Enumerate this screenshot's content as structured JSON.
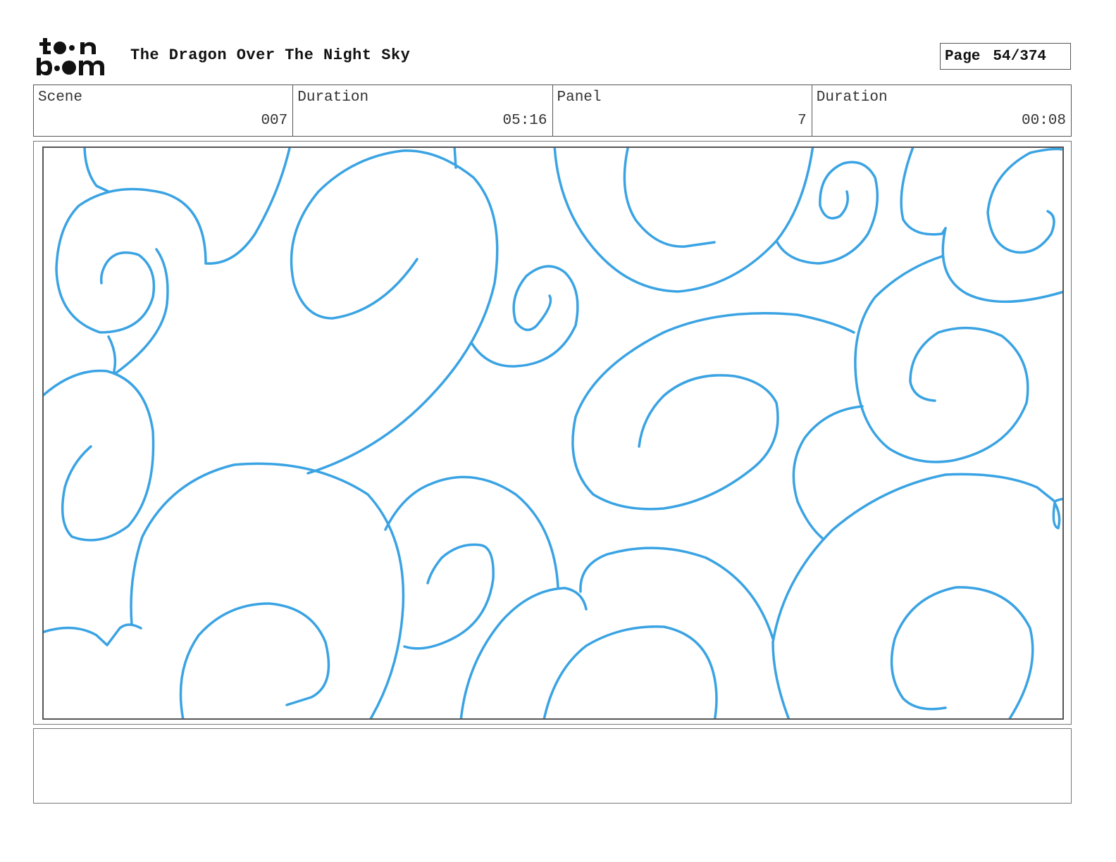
{
  "header": {
    "logo_alt": "toon boom",
    "title": "The Dragon Over The Night Sky",
    "page_label": "Page",
    "page_value": "54/374"
  },
  "info": {
    "scene_label": "Scene",
    "scene_value": "007",
    "scene_duration_label": "Duration",
    "scene_duration_value": "05:16",
    "panel_label": "Panel",
    "panel_value": "7",
    "panel_duration_label": "Duration",
    "panel_duration_value": "00:08"
  },
  "drawing": {
    "stroke_color": "#3aa3e3",
    "description_icon": "swirl-cloud-pattern"
  },
  "notes": {
    "text": ""
  }
}
